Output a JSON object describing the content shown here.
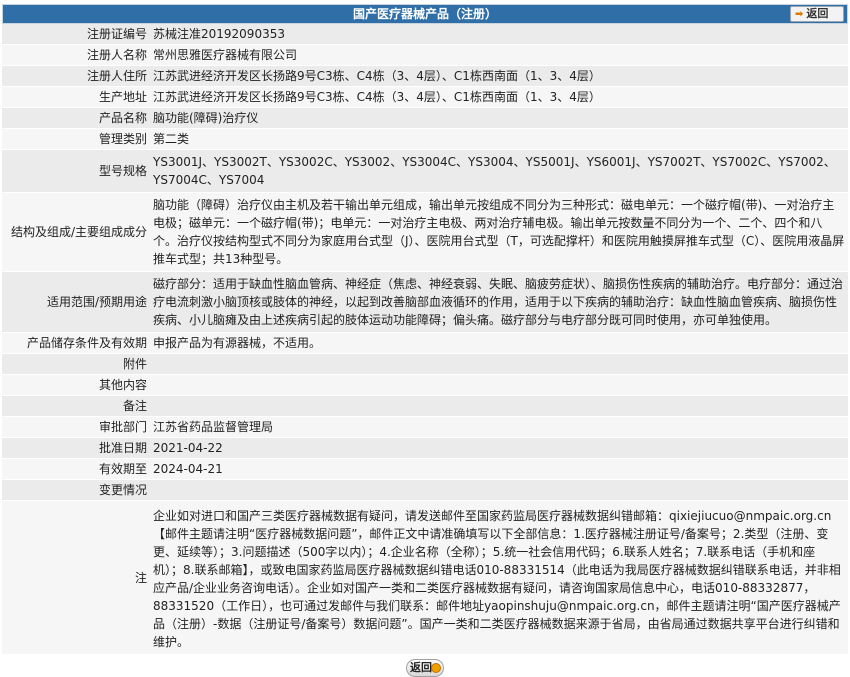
{
  "header": {
    "title": "国产医疗器械产品（注册）",
    "back_label": "返回"
  },
  "rows": [
    {
      "label": "注册证编号",
      "value": "苏械注准20192090353"
    },
    {
      "label": "注册人名称",
      "value": "常州思雅医疗器械有限公司"
    },
    {
      "label": "注册人住所",
      "value": "江苏武进经济开发区长扬路9号C3栋、C4栋（3、4层）、C1栋西南面（1、3、4层）"
    },
    {
      "label": "生产地址",
      "value": "江苏武进经济开发区长扬路9号C3栋、C4栋（3、4层）、C1栋西南面（1、3、4层）"
    },
    {
      "label": "产品名称",
      "value": "脑功能(障碍)治疗仪"
    },
    {
      "label": "管理类别",
      "value": "第二类"
    },
    {
      "label": "型号规格",
      "value": "YS3001J、YS3002T、YS3002C、YS3002、YS3004C、YS3004、YS5001J、YS6001J、YS7002T、YS7002C、YS7002、YS7004C、YS7004"
    },
    {
      "label": "结构及组成/主要组成成分",
      "value": "脑功能（障碍）治疗仪由主机及若干输出单元组成，输出单元按组成不同分为三种形式：磁电单元：一个磁疗帽(带)、一对治疗主电极；磁单元：一个磁疗帽(带)；电单元：一对治疗主电极、两对治疗辅电极。输出单元按数量不同分为一个、二个、四个和八个。治疗仪按结构型式不同分为家庭用台式型（J）、医院用台式型（T，可选配撑杆）和医院用触摸屏推车式型（C）、医院用液晶屏推车式型；共13种型号。"
    },
    {
      "label": "适用范围/预期用途",
      "value": "磁疗部分：适用于缺血性脑血管病、神经症（焦虑、神经衰弱、失眠、脑疲劳症状）、脑损伤性疾病的辅助治疗。电疗部分：通过治疗电流刺激小脑顶核或肢体的神经，以起到改善脑部血液循环的作用，适用于以下疾病的辅助治疗：缺血性脑血管疾病、脑损伤性疾病、小儿脑瘫及由上述疾病引起的肢体运动功能障碍；偏头痛。磁疗部分与电疗部分既可同时使用，亦可单独使用。"
    },
    {
      "label": "产品储存条件及有效期",
      "value": "申报产品为有源器械，不适用。"
    },
    {
      "label": "附件",
      "value": ""
    },
    {
      "label": "其他内容",
      "value": ""
    },
    {
      "label": "备注",
      "value": ""
    },
    {
      "label": "审批部门",
      "value": "江苏省药品监督管理局"
    },
    {
      "label": "批准日期",
      "value": "2021-04-22"
    },
    {
      "label": "有效期至",
      "value": "2024-04-21"
    },
    {
      "label": "变更情况",
      "value": ""
    },
    {
      "label": "注",
      "value": "企业如对进口和国产三类医疗器械数据有疑问，请发送邮件至国家药监局医疗器械数据纠错邮箱：qixiejiucuo@nmpaic.org.cn【邮件主题请注明“医疗器械数据问题”，邮件正文中请准确填写以下全部信息：1.医疗器械注册证号/备案号；2.类型（注册、变更、延续等）；3.问题描述（500字以内）；4.企业名称（全称）；5.统一社会信用代码；6.联系人姓名；7.联系电话（手机和座机）；8.联系邮箱】，或致电国家药监局医疗器械数据纠错电话010-88331514（此电话为我局医疗器械数据纠错联系电话，并非相应产品/企业业务咨询电话）。企业如对国产一类和二类医疗器械数据有疑问，请咨询国家局信息中心，电话010-88332877，88331520（工作日），也可通过发邮件与我们联系：邮件地址yaopinshuju@nmpaic.org.cn，邮件主题请注明“国产医疗器械产品（注册）-数据（注册证号/备案号）数据问题”。国产一类和二类医疗器械数据来源于省局，由省局通过数据共享平台进行纠错和维护。"
    }
  ],
  "footer": {
    "return_label": "返回"
  }
}
